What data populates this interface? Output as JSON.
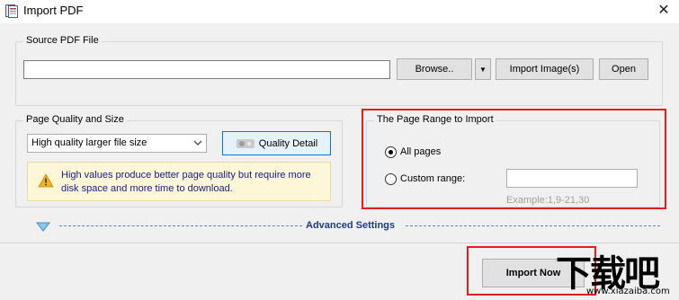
{
  "window": {
    "title": "Import PDF",
    "close_glyph": "✕"
  },
  "source": {
    "group_label": "Source PDF File",
    "path_value": "",
    "browse_label": "Browse..",
    "dropdown_glyph": "▼",
    "import_images_label": "Import Image(s)",
    "open_label": "Open"
  },
  "quality": {
    "group_label": "Page Quality and Size",
    "selected_option": "High quality larger file size",
    "detail_button_label": "Quality Detail",
    "info_text": "High values produce better page quality but require more disk space and more time to download."
  },
  "range": {
    "group_label": "The Page Range to Import",
    "all_pages_label": "All pages",
    "all_pages_selected": true,
    "custom_range_label": "Custom range:",
    "custom_range_value": "",
    "example_text": "Example:1,9-21,30"
  },
  "advanced": {
    "label": "Advanced Settings"
  },
  "footer": {
    "import_now_label": "Import Now"
  },
  "watermark": {
    "main_text": "下载吧",
    "sub_text": "www.xiazaiba.com"
  },
  "colors": {
    "highlight": "#e41e1e",
    "info_text": "#1a1a8a",
    "advanced_text": "#1c3a86"
  },
  "icons": {
    "app": "pdf-document-icon",
    "warning": "warning-icon",
    "advanced_toggle": "triangle-down-icon",
    "quality_detail": "gear-icon"
  }
}
